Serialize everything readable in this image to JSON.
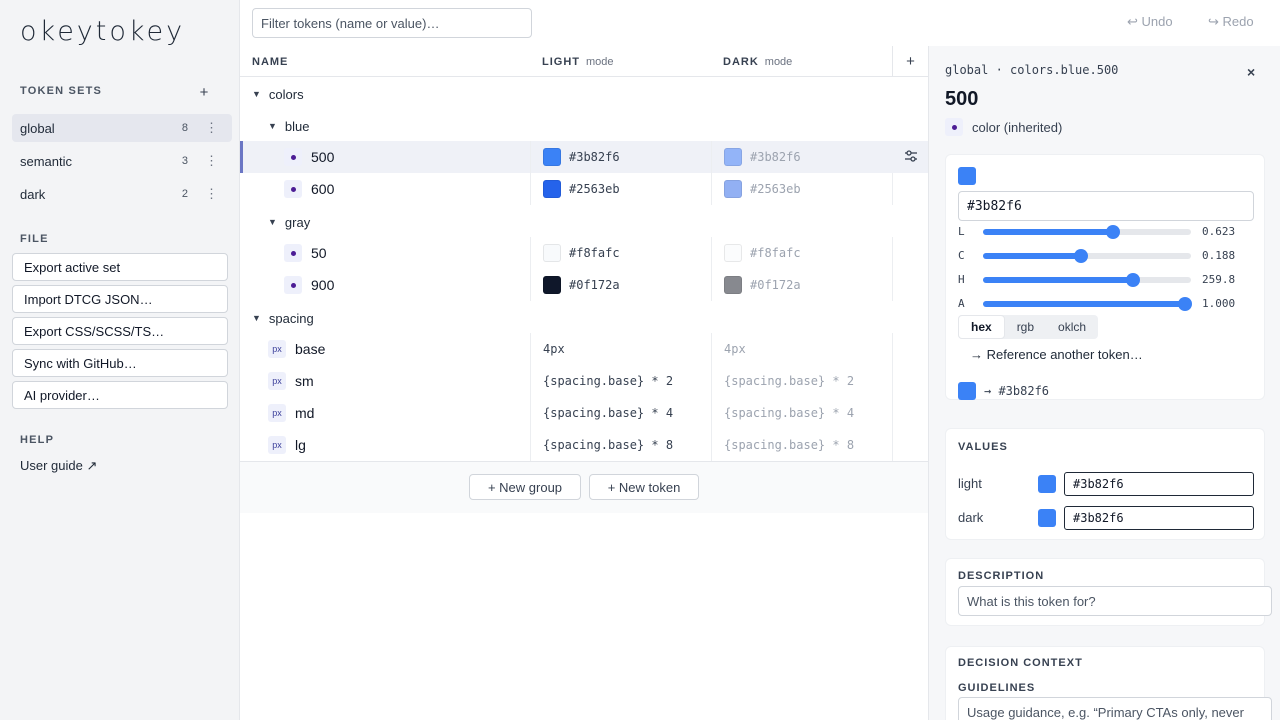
{
  "app": {
    "logo": "okeytokey"
  },
  "sidebar": {
    "token_sets_label": "TOKEN SETS",
    "add_icon": "+",
    "sets": [
      {
        "name": "global",
        "count": "8",
        "menu": "⋮",
        "active": true
      },
      {
        "name": "semantic",
        "count": "3",
        "menu": "⋮",
        "active": false
      },
      {
        "name": "dark",
        "count": "2",
        "menu": "⋮",
        "active": false
      }
    ],
    "file_label": "FILE",
    "file_buttons": [
      "Export active set",
      "Import DTCG JSON…",
      "Export CSS/SCSS/TS…",
      "Sync with GitHub…",
      "AI provider…"
    ],
    "help_label": "HELP",
    "user_guide": "User guide ↗"
  },
  "toolbar": {
    "filter_placeholder": "Filter tokens (name or value)…",
    "undo": "↩ Undo",
    "redo": "↪ Redo"
  },
  "table": {
    "columns": {
      "name": "NAME",
      "light": "LIGHT",
      "dark": "DARK",
      "mode_suffix": "mode",
      "add": "+"
    },
    "groups": {
      "colors": "colors",
      "blue": "blue",
      "gray": "gray",
      "spacing": "spacing"
    },
    "caret": "▼",
    "color_tokens": [
      {
        "name": "500",
        "light": "#3b82f6",
        "dark": "#3b82f6",
        "light_swatch": "#3b82f6",
        "dark_swatch": "#93b4f8",
        "selected": true
      },
      {
        "name": "600",
        "light": "#2563eb",
        "dark": "#2563eb",
        "light_swatch": "#2563eb",
        "dark_swatch": "#92b0f3"
      },
      {
        "name": "50",
        "light": "#f8fafc",
        "dark": "#f8fafc",
        "light_swatch": "#f8fafc",
        "dark_swatch": "#fbfcfd"
      },
      {
        "name": "900",
        "light": "#0f172a",
        "dark": "#0f172a",
        "light_swatch": "#0f172a",
        "dark_swatch": "#87898f"
      }
    ],
    "spacing_badge": "px",
    "spacing_tokens": [
      {
        "name": "base",
        "light": "4px",
        "dark": "4px"
      },
      {
        "name": "sm",
        "light": "{spacing.base} * 2",
        "dark": "{spacing.base} * 2"
      },
      {
        "name": "md",
        "light": "{spacing.base} * 4",
        "dark": "{spacing.base} * 4"
      },
      {
        "name": "lg",
        "light": "{spacing.base} * 8",
        "dark": "{spacing.base} * 8"
      }
    ],
    "new_group": "+ New group",
    "new_token": "+ New token"
  },
  "detail": {
    "breadcrumb": "global · colors.blue.500",
    "close": "×",
    "title": "500",
    "type": "color (inherited)",
    "swatch_color": "#3b82f6",
    "hex_value": "#3b82f6",
    "sliders": [
      {
        "label": "L",
        "value": "0.623",
        "fraction": 0.623
      },
      {
        "label": "C",
        "value": "0.188",
        "fraction": 0.47
      },
      {
        "label": "H",
        "value": "259.8",
        "fraction": 0.7217
      },
      {
        "label": "A",
        "value": "1.000",
        "fraction": 0.97
      }
    ],
    "formats": [
      "hex",
      "rgb",
      "oklch"
    ],
    "active_format": "hex",
    "reference_link": "→ Reference another token…",
    "resolved": "→ #3b82f6",
    "values_label": "VALUES",
    "values": [
      {
        "mode": "light",
        "value": "#3b82f6"
      },
      {
        "mode": "dark",
        "value": "#3b82f6"
      }
    ],
    "description_label": "DESCRIPTION",
    "description_placeholder": "What is this token for?",
    "decision_label": "DECISION CONTEXT",
    "guidelines_label": "GUIDELINES",
    "guidelines_placeholder": "Usage guidance, e.g. “Primary CTAs only, never"
  },
  "colors": {
    "accent": "#3b82f6",
    "selection_bar": "#6b76c4"
  }
}
